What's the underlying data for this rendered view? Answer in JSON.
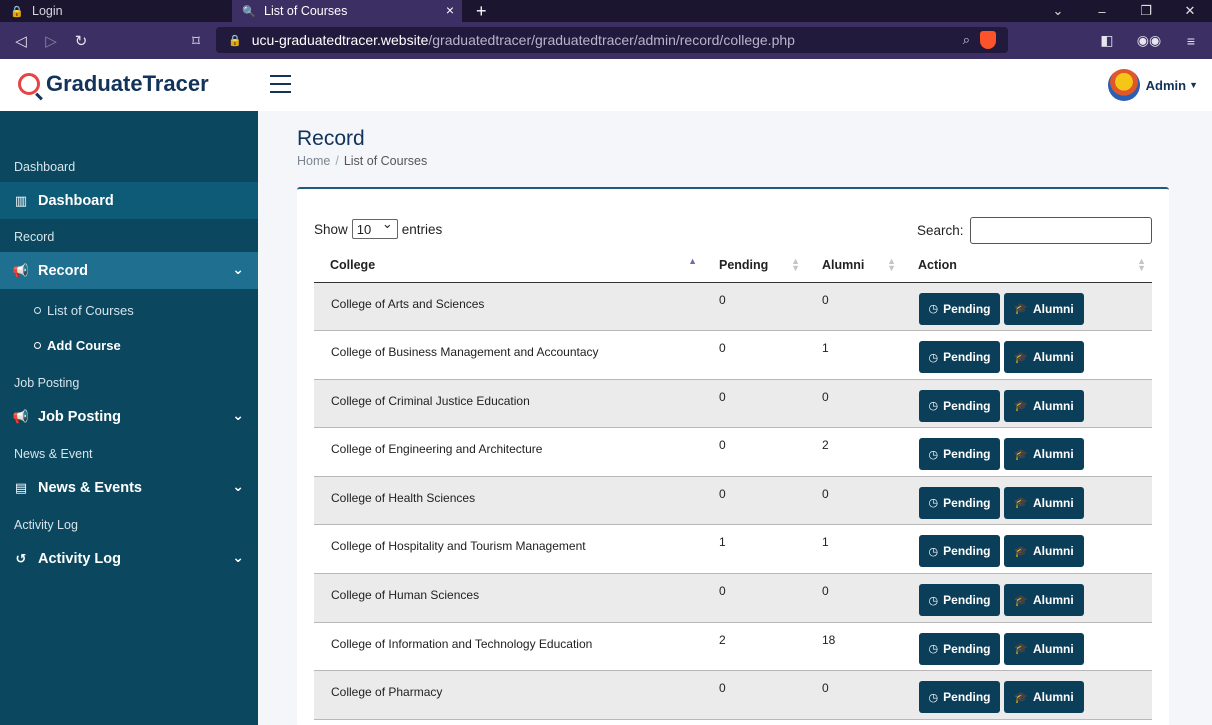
{
  "browser": {
    "tabs": [
      {
        "label": "Login",
        "icon": "lock-fav-icon"
      },
      {
        "label": "List of Courses",
        "icon": "tracer-fav-icon"
      }
    ],
    "url_domain": "ucu-graduatedtracer.website",
    "url_path": "/graduatedtracer/graduatedtracer/admin/record/college.php"
  },
  "header": {
    "brand": "GraduateTracer",
    "user": "Admin"
  },
  "sidebar": {
    "sections": [
      {
        "heading": "Dashboard",
        "item": "Dashboard",
        "icon": "bar-chart-icon"
      },
      {
        "heading": "Record",
        "item": "Record",
        "icon": "megaphone-icon"
      },
      {
        "heading": "Job Posting",
        "item": "Job Posting",
        "icon": "megaphone-icon"
      },
      {
        "heading": "News & Event",
        "item": "News & Events",
        "icon": "newspaper-icon"
      },
      {
        "heading": "Activity Log",
        "item": "Activity Log",
        "icon": "history-icon"
      }
    ],
    "record_sub": [
      "List of Courses",
      "Add Course"
    ]
  },
  "main": {
    "title": "Record",
    "breadcrumb_home": "Home",
    "breadcrumb_current": "List of Courses",
    "show_label": "Show",
    "entries_value": "10",
    "entries_label": "entries",
    "search_label": "Search:",
    "columns": [
      "College",
      "Pending",
      "Alumni",
      "Action"
    ],
    "pending_btn": "Pending",
    "alumni_btn": "Alumni",
    "rows": [
      {
        "college": "College of Arts and Sciences",
        "pending": "0",
        "alumni": "0"
      },
      {
        "college": "College of Business Management and Accountacy",
        "pending": "0",
        "alumni": "1"
      },
      {
        "college": "College of Criminal Justice Education",
        "pending": "0",
        "alumni": "0"
      },
      {
        "college": "College of Engineering and Architecture",
        "pending": "0",
        "alumni": "2"
      },
      {
        "college": "College of Health Sciences",
        "pending": "0",
        "alumni": "0"
      },
      {
        "college": "College of Hospitality and Tourism Management",
        "pending": "1",
        "alumni": "1"
      },
      {
        "college": "College of Human Sciences",
        "pending": "0",
        "alumni": "0"
      },
      {
        "college": "College of Information and Technology Education",
        "pending": "2",
        "alumni": "18"
      },
      {
        "college": "College of Pharmacy",
        "pending": "0",
        "alumni": "0"
      }
    ]
  }
}
